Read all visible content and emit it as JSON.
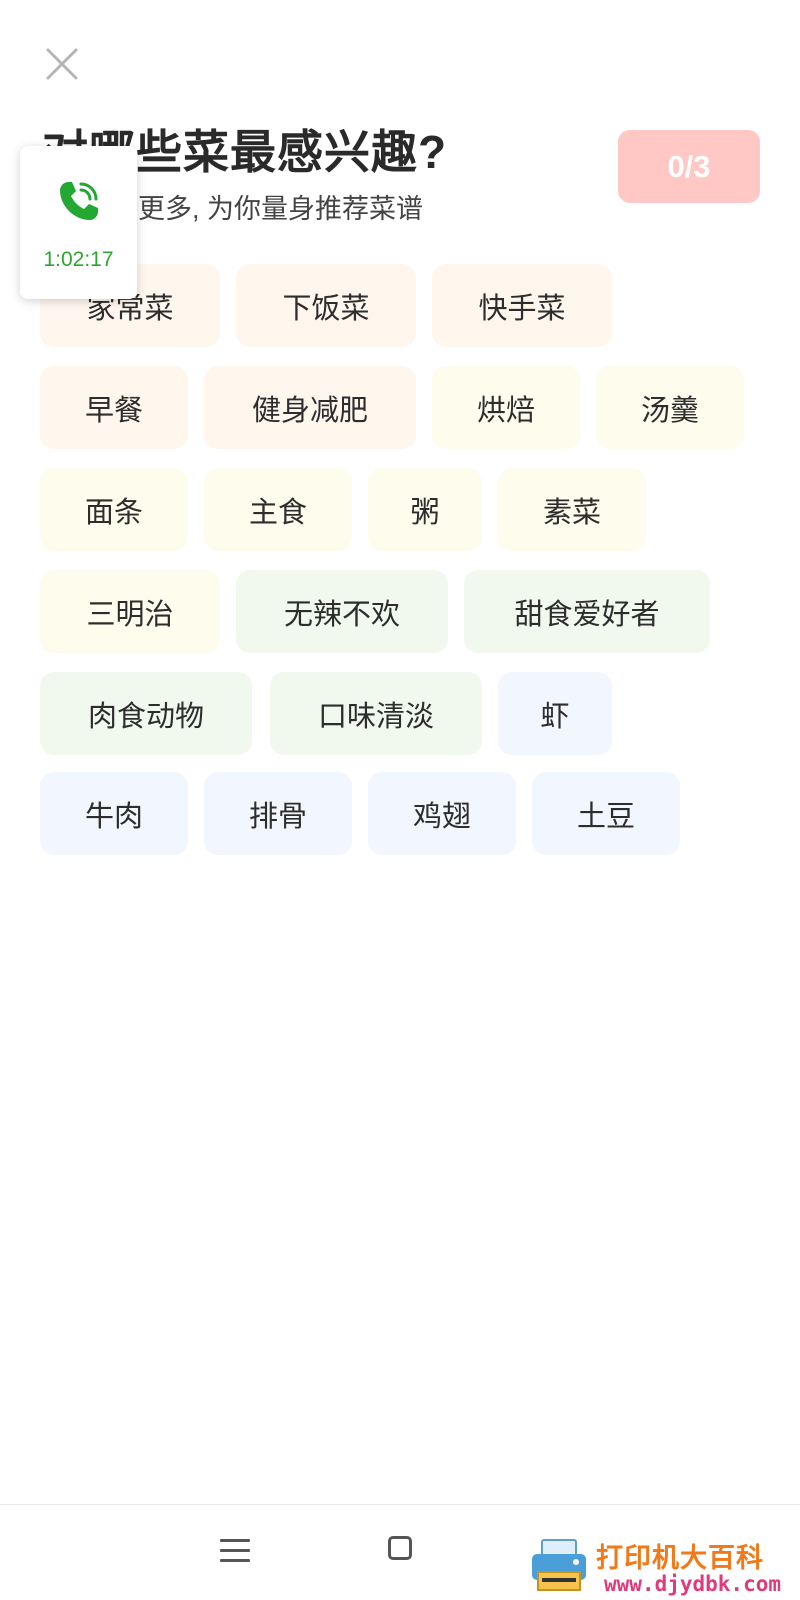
{
  "header": {
    "title": "对哪些菜最感兴趣?",
    "subtitle": "选3个或更多, 为你量身推荐菜谱",
    "counter": "0/3",
    "close_icon": "close-icon"
  },
  "call_float": {
    "icon": "phone-call-icon",
    "timer": "1:02:17"
  },
  "tags": [
    {
      "label": "家常菜",
      "color": "#fff6ee"
    },
    {
      "label": "下饭菜",
      "color": "#fff6ee"
    },
    {
      "label": "快手菜",
      "color": "#fff6ee"
    },
    {
      "label": "早餐",
      "color": "#fff6ee"
    },
    {
      "label": "健身减肥",
      "color": "#fff6ee"
    },
    {
      "label": "烘焙",
      "color": "#fefcec"
    },
    {
      "label": "汤羹",
      "color": "#fefcec"
    },
    {
      "label": "面条",
      "color": "#fefcec"
    },
    {
      "label": "主食",
      "color": "#fefcec"
    },
    {
      "label": "粥",
      "color": "#fefcec"
    },
    {
      "label": "素菜",
      "color": "#fefcec"
    },
    {
      "label": "三明治",
      "color": "#fefcec"
    },
    {
      "label": "无辣不欢",
      "color": "#f1f9ef"
    },
    {
      "label": "甜食爱好者",
      "color": "#f1f9ef"
    },
    {
      "label": "肉食动物",
      "color": "#f1f9ef"
    },
    {
      "label": "口味清淡",
      "color": "#f1f9ef"
    },
    {
      "label": "虾",
      "color": "#f2f6fe"
    },
    {
      "label": "牛肉",
      "color": "#f2f6fe"
    },
    {
      "label": "排骨",
      "color": "#f2f6fe"
    },
    {
      "label": "鸡翅",
      "color": "#f2f6fe"
    },
    {
      "label": "土豆",
      "color": "#f2f6fe"
    }
  ],
  "nav": {
    "menu_icon": "menu-icon",
    "home_icon": "home-square-icon"
  },
  "watermark": {
    "text": "打印机大百科",
    "domain": "www.djydbk.com"
  },
  "colors": {
    "counter_bg": "#ffc8c4",
    "call_green": "#2fa52f"
  }
}
